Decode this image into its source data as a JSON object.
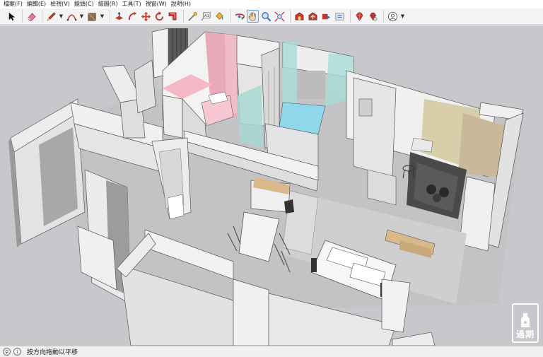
{
  "menu": [
    {
      "label": "檔案(F)"
    },
    {
      "label": "編輯(E)"
    },
    {
      "label": "檢視(V)"
    },
    {
      "label": "鏡頭(C)"
    },
    {
      "label": "繪圖(R)"
    },
    {
      "label": "工具(T)"
    },
    {
      "label": "視窗(W)"
    },
    {
      "label": "說明(H)"
    }
  ],
  "toolbar": {
    "active_tool": "pan-icon",
    "colors": {
      "eraser": "#e8759a",
      "pencil": "#c0392b",
      "arc": "#c0392b",
      "push_pull": "#c0392b",
      "orbit": "#c0392b",
      "rotate": "#c0392b",
      "move": "#d03a2a",
      "rect": "#8b6f4a",
      "zoom": "#3a6fc4",
      "ruby": "#c0392b"
    }
  },
  "statusbar": {
    "text": "按方向拖動以平移"
  },
  "watermark": {
    "label": "過期"
  }
}
